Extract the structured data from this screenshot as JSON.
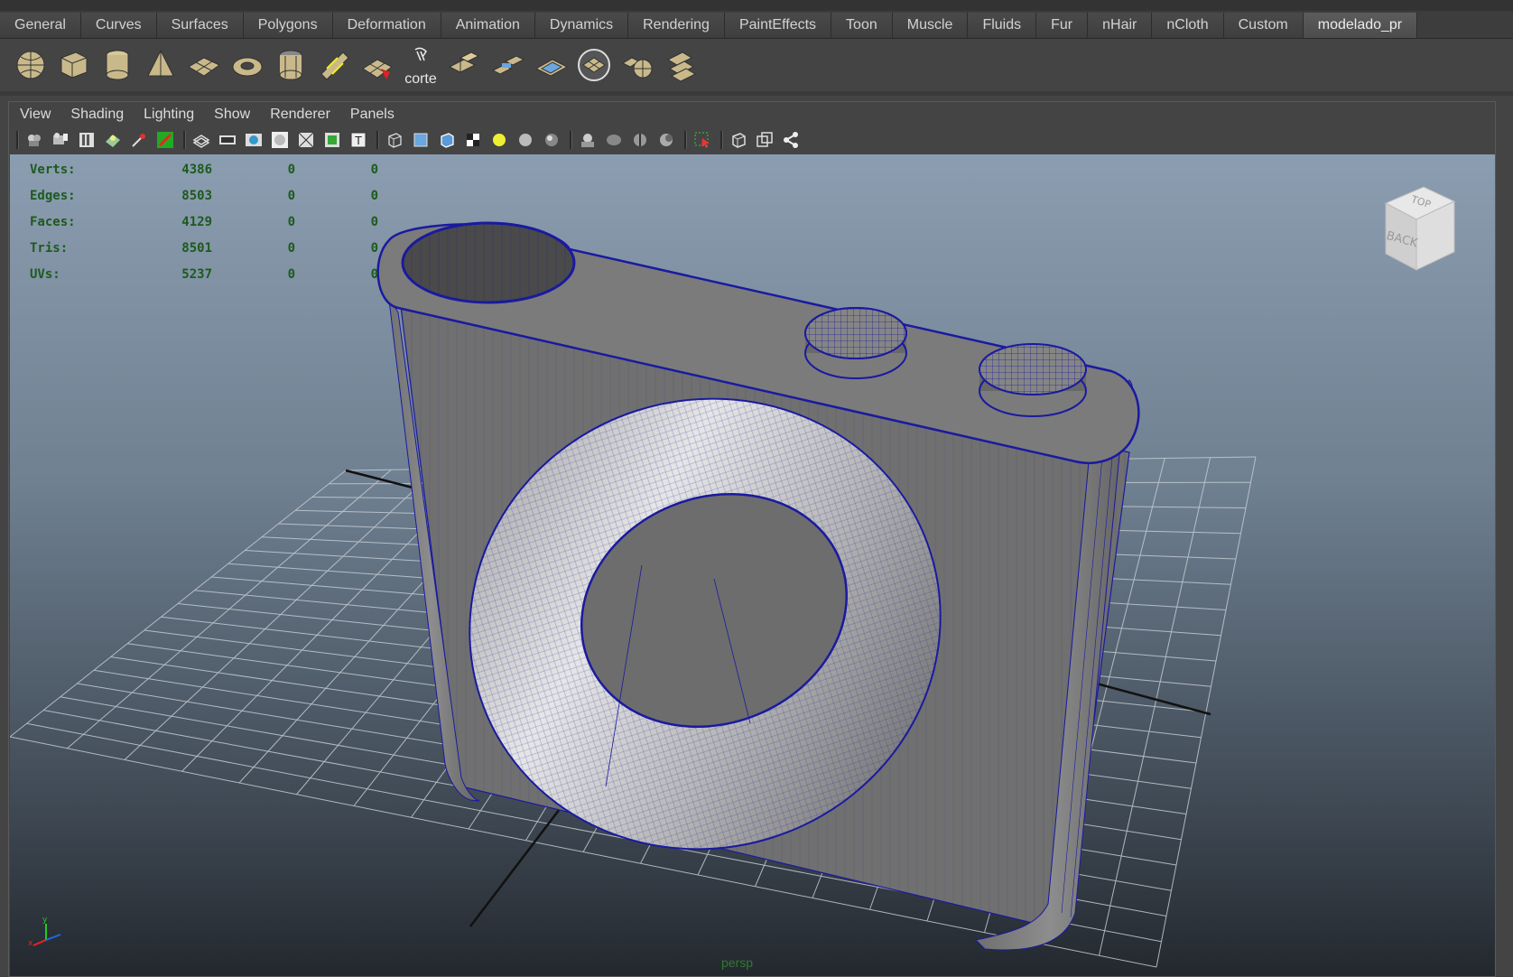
{
  "shelf": {
    "tabs": [
      "General",
      "Curves",
      "Surfaces",
      "Polygons",
      "Deformation",
      "Animation",
      "Dynamics",
      "Rendering",
      "PaintEffects",
      "Toon",
      "Muscle",
      "Fluids",
      "Fur",
      "nHair",
      "nCloth",
      "Custom",
      "modelado_pr"
    ],
    "active_tab": "modelado_pr",
    "icons": [
      {
        "name": "poly-sphere-icon"
      },
      {
        "name": "poly-cube-icon"
      },
      {
        "name": "poly-cylinder-icon"
      },
      {
        "name": "poly-cone-icon"
      },
      {
        "name": "poly-plane-icon"
      },
      {
        "name": "poly-torus-icon"
      },
      {
        "name": "poly-pipe-icon"
      },
      {
        "name": "poly-helix-icon"
      },
      {
        "name": "poly-soccer-ball-icon"
      },
      {
        "name": "corte-icon",
        "label": "corte"
      },
      {
        "name": "extrude-icon"
      },
      {
        "name": "bridge-icon"
      },
      {
        "name": "bevel-icon"
      },
      {
        "name": "smooth-icon"
      },
      {
        "name": "combine-icon"
      },
      {
        "name": "separate-icon"
      }
    ]
  },
  "panel": {
    "menu": [
      "View",
      "Shading",
      "Lighting",
      "Show",
      "Renderer",
      "Panels"
    ]
  },
  "hud": {
    "rows": [
      {
        "label": "Verts:",
        "value": "4386",
        "c1": "0",
        "c2": "0"
      },
      {
        "label": "Edges:",
        "value": "8503",
        "c1": "0",
        "c2": "0"
      },
      {
        "label": "Faces:",
        "value": "4129",
        "c1": "0",
        "c2": "0"
      },
      {
        "label": "Tris:",
        "value": "8501",
        "c1": "0",
        "c2": "0"
      },
      {
        "label": "UVs:",
        "value": "5237",
        "c1": "0",
        "c2": "0"
      }
    ]
  },
  "viewport": {
    "camera_name": "persp",
    "viewcube_face_top": "TOP",
    "viewcube_face_front": "BACK"
  },
  "colors": {
    "wireframe": "#1a1aa0",
    "hud_text": "#1d5a1d",
    "model_gray": "#7a7a7a"
  }
}
